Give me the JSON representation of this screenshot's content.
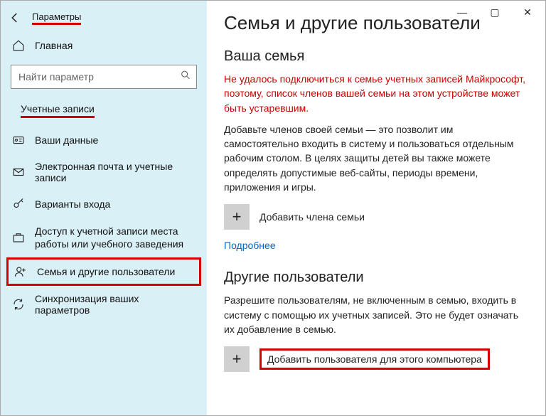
{
  "app_title": "Параметры",
  "window_controls": {
    "min": "—",
    "max": "▢",
    "close": "✕"
  },
  "sidebar": {
    "home_label": "Главная",
    "search_placeholder": "Найти параметр",
    "section_label": "Учетные записи",
    "items": {
      "your_data": "Ваши данные",
      "email": "Электронная почта и учетные записи",
      "signin": "Варианты входа",
      "work_access": "Доступ к учетной записи места работы или учебного заведения",
      "family": "Семья и другие пользователи",
      "sync": "Синхронизация ваших параметров"
    }
  },
  "main": {
    "title": "Семья и другие пользователи",
    "family_heading": "Ваша семья",
    "error_text": "Не удалось подключиться к семье учетных записей Майкрософт, поэтому, список членов вашей семьи на этом устройстве может быть устаревшим.",
    "family_body": "Добавьте членов своей семьи — это позволит им самостоятельно входить в систему и пользоваться отдельным рабочим столом. В целях защиты детей вы также можете определять допустимые веб-сайты, периоды времени, приложения и игры.",
    "add_family_label": "Добавить члена семьи",
    "more_link": "Подробнее",
    "others_heading": "Другие пользователи",
    "others_body": "Разрешите пользователям, не включенным в семью, входить в систему с помощью их учетных записей. Это не будет означать их добавление в семью.",
    "add_other_label": "Добавить пользователя для этого компьютера"
  }
}
